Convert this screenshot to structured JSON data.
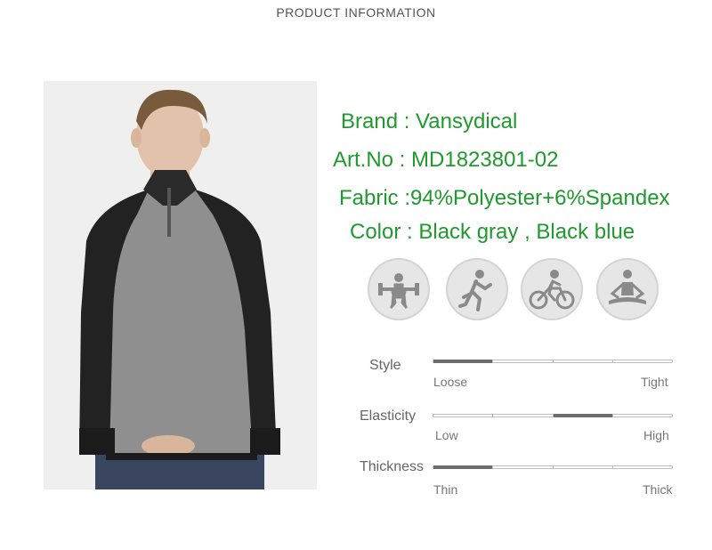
{
  "header": {
    "title": "PRODUCT INFORMATION"
  },
  "specs": {
    "brand": "Brand : Vansydical",
    "art_no": "Art.No : MD1823801-02",
    "fabric": "Fabric :94%Polyester+6%Spandex",
    "color": "Color : Black gray , Black blue",
    "text_color": "#1f9a2e"
  },
  "activity_icons": [
    "weightlifting-icon",
    "running-icon",
    "cycling-icon",
    "yoga-icon"
  ],
  "scales": [
    {
      "label": "Style",
      "low": "Loose",
      "high": "Tight",
      "level_segment": 1,
      "segments": 4
    },
    {
      "label": "Elasticity",
      "low": "Low",
      "high": "High",
      "level_segment": 3,
      "segments": 4
    },
    {
      "label": "Thickness",
      "low": "Thin",
      "high": "Thick",
      "level_segment": 1,
      "segments": 4
    }
  ],
  "colors": {
    "bar_fill": "#6d6d6d",
    "icon_bg": "#e6e6e6",
    "icon_fg": "#8a8a8a"
  }
}
